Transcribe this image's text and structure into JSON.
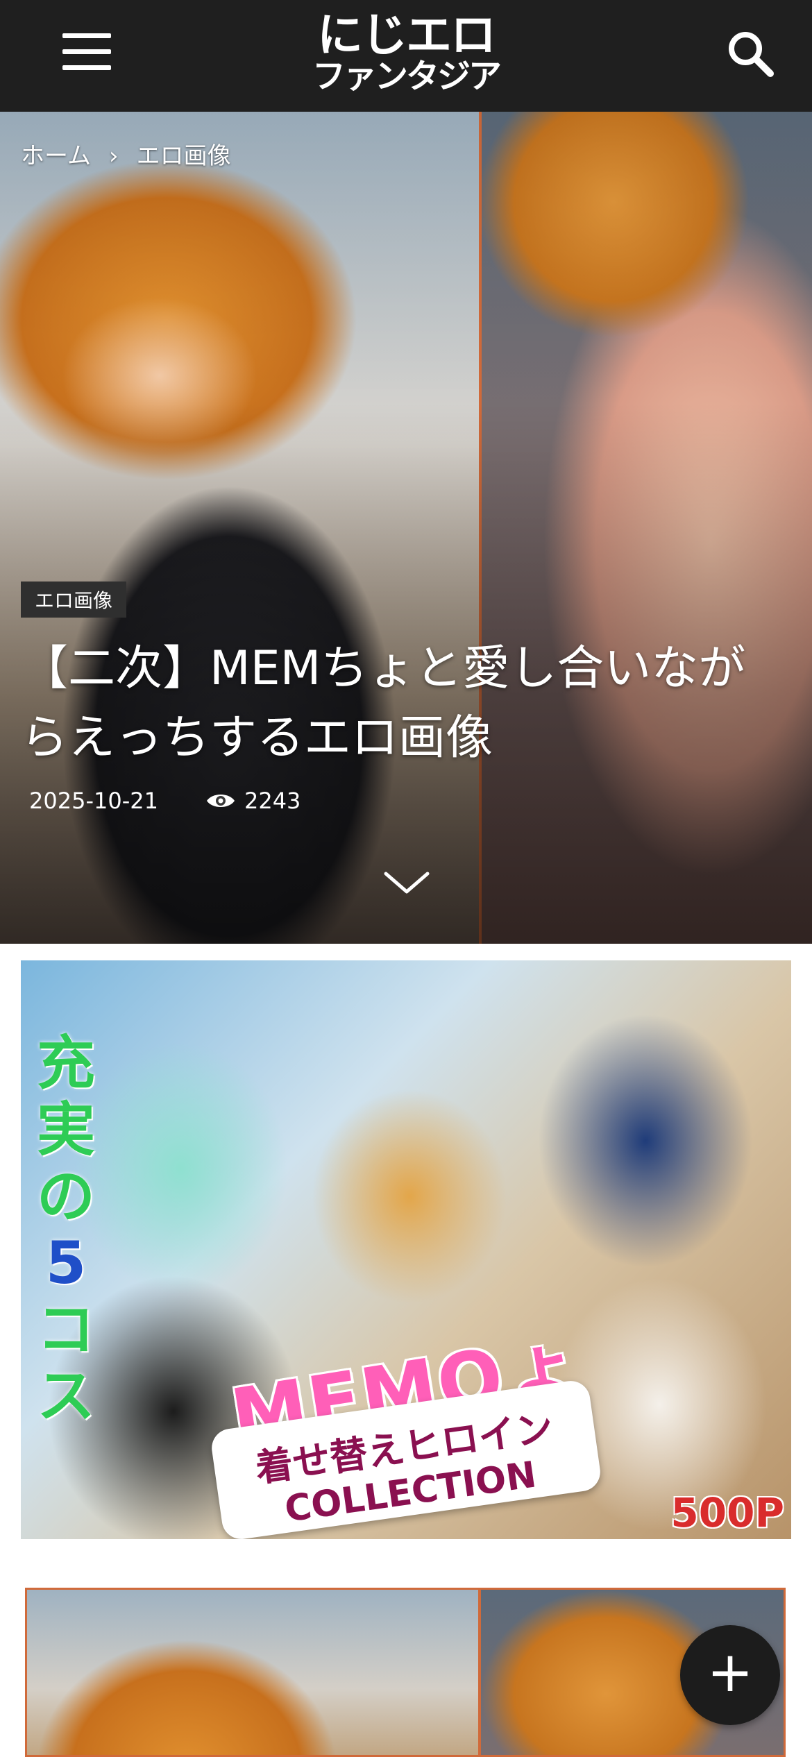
{
  "header": {
    "logo_line1": "にじエロ",
    "logo_line2": "ファンタジア",
    "menu_icon": "hamburger-menu-icon",
    "search_icon": "search-icon"
  },
  "breadcrumb": {
    "home": "ホーム",
    "separator": "›",
    "current": "エロ画像"
  },
  "article": {
    "category": "エロ画像",
    "title": "【二次】MEMちょと愛し合いながらえっちするエロ画像",
    "date": "2025-10-21",
    "views": "2243",
    "views_icon": "eye-icon",
    "scroll_icon": "chevron-down-icon"
  },
  "ad": {
    "side_text_1": "充実の",
    "side_text_2": "5",
    "side_text_3": "コス",
    "brand": "MEMOょ",
    "subtitle_1": "着せ替えヒロイン",
    "subtitle_2": "COLLECTION",
    "price": "500P"
  },
  "fab": {
    "label": "+",
    "icon": "plus-icon"
  },
  "colors": {
    "header_bg": "#1f1f1f",
    "badge_bg": "#2f2f2f",
    "accent_border": "#d06a3a",
    "ad_brand_pink": "#ff5fb8",
    "ad_price_red": "#d92c2c"
  }
}
